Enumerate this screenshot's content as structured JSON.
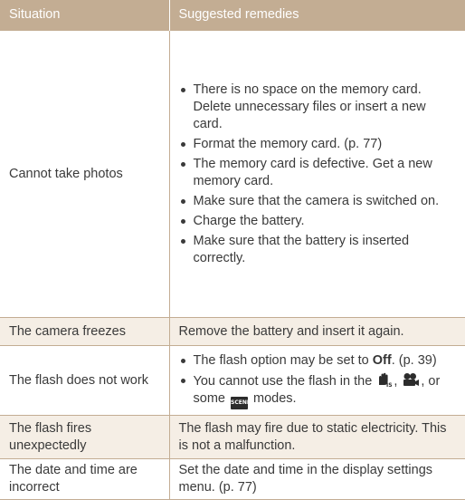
{
  "header": {
    "situation": "Situation",
    "remedies": "Suggested remedies"
  },
  "rows": [
    {
      "situation": "Cannot take photos",
      "remedies": [
        "There is no space on the memory card. Delete unnecessary files or insert a new card.",
        "Format the memory card. (p. 77)",
        "The memory card is defective. Get a new memory card.",
        "Make sure that the camera is switched on.",
        "Charge the battery.",
        "Make sure that the battery is inserted correctly."
      ]
    },
    {
      "situation": "The camera freezes",
      "remedy": "Remove the battery and insert it again."
    },
    {
      "situation": "The flash does not work",
      "remedy_a_prefix": "The flash option may be set to ",
      "remedy_a_bold": "Off",
      "remedy_a_suffix": ". (p. 39)",
      "remedy_b_prefix": "You cannot use the flash in the ",
      "remedy_b_mid": ", ",
      "remedy_b_after_icons": ", or some ",
      "remedy_b_suffix": " modes.",
      "scene_icon_text": "SCENE",
      "icons": [
        "dual-is-hand-icon",
        "movie-camera-icon",
        "scene-mode-icon"
      ]
    },
    {
      "situation": "The flash fires unexpectedly",
      "remedy": "The flash may fire due to static electricity. This is not a malfunction."
    },
    {
      "situation": "The date and time are incorrect",
      "remedy": "Set the date and time in the display settings menu. (p. 77)"
    }
  ],
  "colors": {
    "header_bg": "#c3ad93",
    "shaded_cell_bg": "#f5eee5",
    "rule": "#c3ad93"
  }
}
